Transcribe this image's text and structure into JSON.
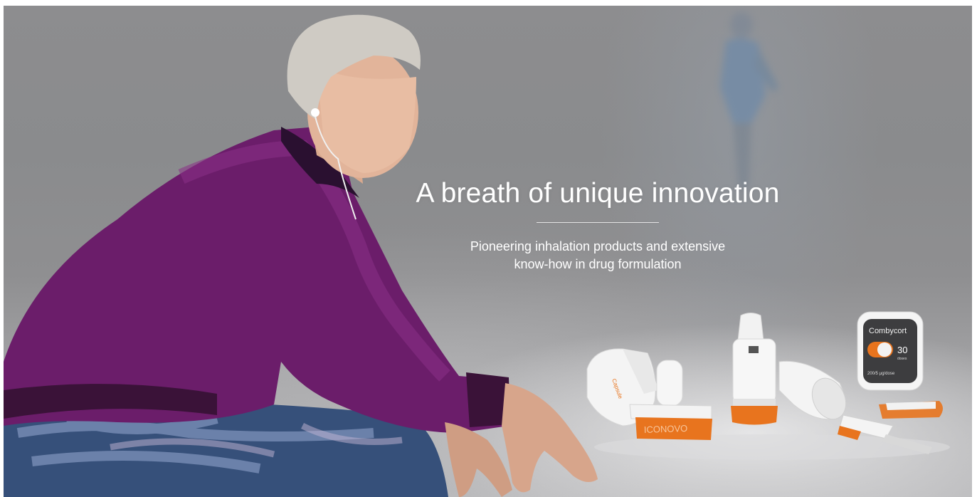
{
  "hero": {
    "headline": "A breath of unique innovation",
    "subtitle_line1": "Pioneering inhalation products and extensive",
    "subtitle_line2": "know-how in drug formulation"
  },
  "products": {
    "inhaler_brand": "ICONOVO",
    "counter_brand": "Combycort",
    "counter_doses": "30",
    "counter_doses_unit": "doses",
    "counter_strength": "200/5 µg/dose",
    "capsule_label": "Capsule"
  },
  "colors": {
    "accent_orange": "#e8741e",
    "jacket_purple": "#6b1d6a",
    "background_fog": "#8e8e90",
    "headline_text": "#ffffff"
  }
}
